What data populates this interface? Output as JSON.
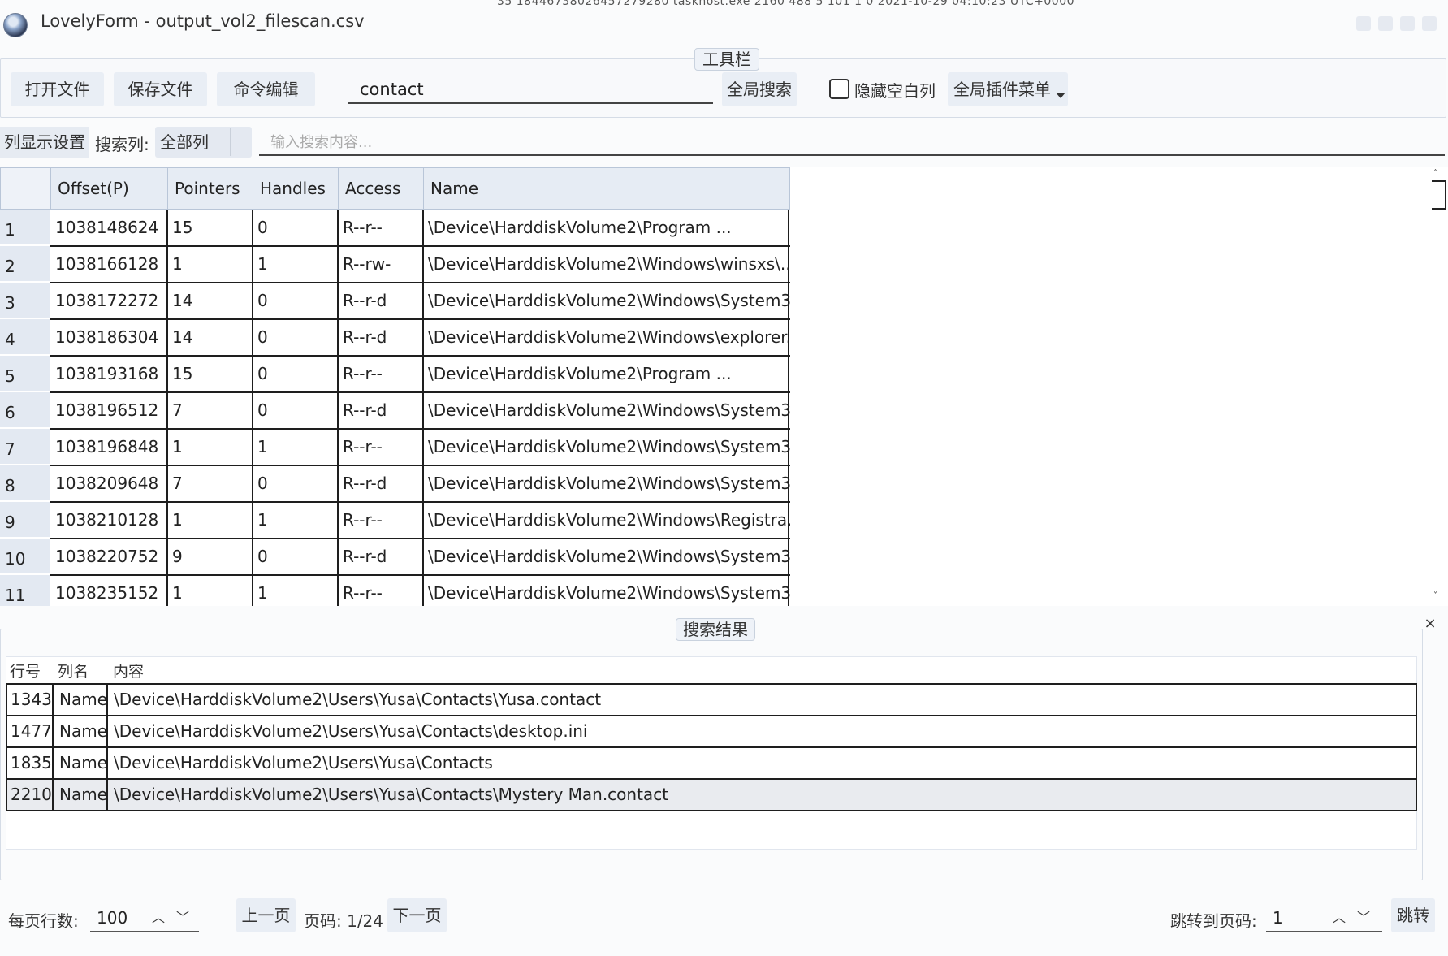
{
  "window": {
    "title": "LovelyForm - output_vol2_filescan.csv",
    "bleed_text": "35   18446738026457279280   taskhost.exe          2160    488    5     101    1     0     2021-10-29 04:10:23 UTC+0000"
  },
  "toolbar": {
    "legend": "工具栏",
    "open_label": "打开文件",
    "save_label": "保存文件",
    "cmd_label": "命令编辑",
    "search_value": "contact",
    "global_search_label": "全局搜索",
    "hide_empty_label": "隐藏空白列",
    "plugin_menu_label": "全局插件菜单"
  },
  "search_row": {
    "column_settings_label": "列显示设置",
    "search_column_label": "搜索列:",
    "search_column_value": "全部列",
    "search_placeholder": "输入搜索内容..."
  },
  "table": {
    "columns": [
      "Offset(P)",
      "Pointers",
      "Handles",
      "Access",
      "Name"
    ],
    "rows": [
      {
        "n": "1",
        "cells": [
          "1038148624",
          "15",
          "0",
          "R--r--",
          "\\Device\\HarddiskVolume2\\Program ..."
        ]
      },
      {
        "n": "2",
        "cells": [
          "1038166128",
          "1",
          "1",
          "R--rw-",
          "\\Device\\HarddiskVolume2\\Windows\\winsxs\\..."
        ]
      },
      {
        "n": "3",
        "cells": [
          "1038172272",
          "14",
          "0",
          "R--r-d",
          "\\Device\\HarddiskVolume2\\Windows\\System3..."
        ]
      },
      {
        "n": "4",
        "cells": [
          "1038186304",
          "14",
          "0",
          "R--r-d",
          "\\Device\\HarddiskVolume2\\Windows\\explorer..."
        ]
      },
      {
        "n": "5",
        "cells": [
          "1038193168",
          "15",
          "0",
          "R--r--",
          "\\Device\\HarddiskVolume2\\Program ..."
        ]
      },
      {
        "n": "6",
        "cells": [
          "1038196512",
          "7",
          "0",
          "R--r-d",
          "\\Device\\HarddiskVolume2\\Windows\\System3..."
        ]
      },
      {
        "n": "7",
        "cells": [
          "1038196848",
          "1",
          "1",
          "R--r--",
          "\\Device\\HarddiskVolume2\\Windows\\System3..."
        ]
      },
      {
        "n": "8",
        "cells": [
          "1038209648",
          "7",
          "0",
          "R--r-d",
          "\\Device\\HarddiskVolume2\\Windows\\System3..."
        ]
      },
      {
        "n": "9",
        "cells": [
          "1038210128",
          "1",
          "1",
          "R--r--",
          "\\Device\\HarddiskVolume2\\Windows\\Registra..."
        ]
      },
      {
        "n": "10",
        "cells": [
          "1038220752",
          "9",
          "0",
          "R--r-d",
          "\\Device\\HarddiskVolume2\\Windows\\System3..."
        ]
      },
      {
        "n": "11",
        "cells": [
          "1038235152",
          "1",
          "1",
          "R--r--",
          "\\Device\\HarddiskVolume2\\Windows\\System3..."
        ]
      }
    ]
  },
  "results": {
    "legend": "搜索结果",
    "close_glyph": "×",
    "headers": [
      "行号",
      "列名",
      "内容"
    ],
    "rows": [
      {
        "line": "1343",
        "col": "Name",
        "content": "\\Device\\HarddiskVolume2\\Users\\Yusa\\Contacts\\Yusa.contact"
      },
      {
        "line": "1477",
        "col": "Name",
        "content": "\\Device\\HarddiskVolume2\\Users\\Yusa\\Contacts\\desktop.ini"
      },
      {
        "line": "1835",
        "col": "Name",
        "content": "\\Device\\HarddiskVolume2\\Users\\Yusa\\Contacts"
      },
      {
        "line": "2210",
        "col": "Name",
        "content": "\\Device\\HarddiskVolume2\\Users\\Yusa\\Contacts\\Mystery Man.contact"
      }
    ],
    "selected_index": 3
  },
  "footer": {
    "rows_per_page_label": "每页行数:",
    "rows_per_page_value": "100",
    "prev_label": "上一页",
    "page_info": "页码: 1/24",
    "next_label": "下一页",
    "goto_label": "跳转到页码:",
    "goto_value": "1",
    "jump_label": "跳转"
  },
  "icons": {
    "spin_up": "︿",
    "spin_down": "﹀",
    "scroll_up": "˄",
    "scroll_down": "˅"
  }
}
